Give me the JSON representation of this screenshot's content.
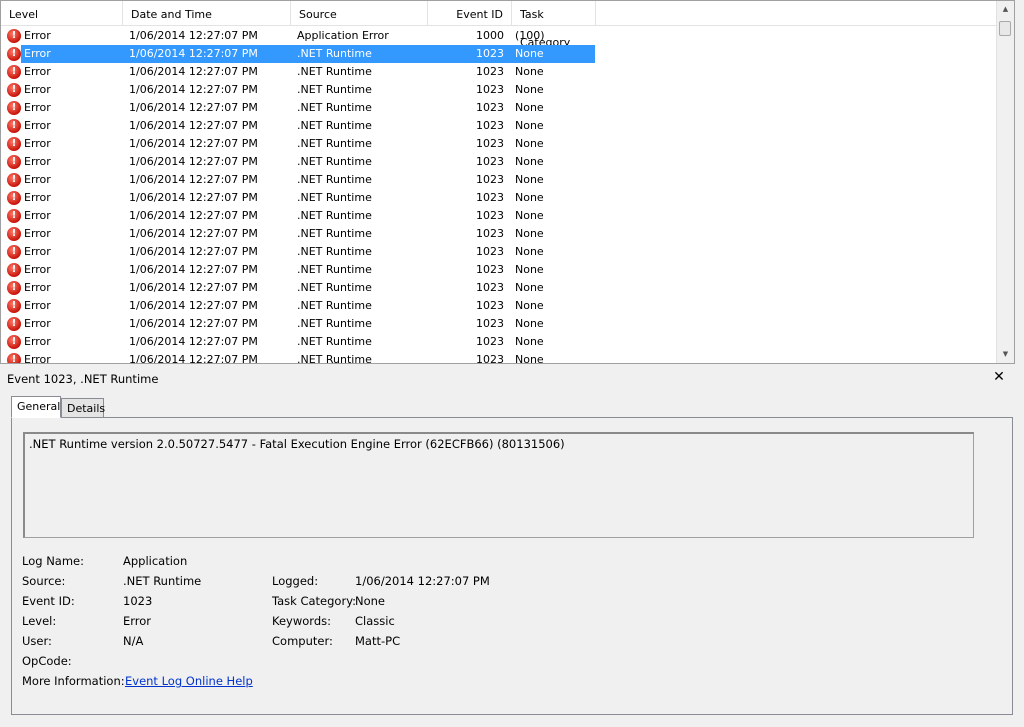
{
  "columns": {
    "level": "Level",
    "date_time": "Date and Time",
    "source": "Source",
    "event_id": "Event ID",
    "task_category": "Task Category"
  },
  "icons": {
    "error": "error-icon",
    "close": "close-icon"
  },
  "colors": {
    "selection": "#3399ff",
    "error_red": "#c8140a",
    "link": "#0033cc"
  },
  "events": [
    {
      "level": "Error",
      "date": "1/06/2014 12:27:07 PM",
      "source": "Application Error",
      "id": "1000",
      "category": "(100)",
      "selected": false
    },
    {
      "level": "Error",
      "date": "1/06/2014 12:27:07 PM",
      "source": ".NET Runtime",
      "id": "1023",
      "category": "None",
      "selected": true
    },
    {
      "level": "Error",
      "date": "1/06/2014 12:27:07 PM",
      "source": ".NET Runtime",
      "id": "1023",
      "category": "None",
      "selected": false
    },
    {
      "level": "Error",
      "date": "1/06/2014 12:27:07 PM",
      "source": ".NET Runtime",
      "id": "1023",
      "category": "None",
      "selected": false
    },
    {
      "level": "Error",
      "date": "1/06/2014 12:27:07 PM",
      "source": ".NET Runtime",
      "id": "1023",
      "category": "None",
      "selected": false
    },
    {
      "level": "Error",
      "date": "1/06/2014 12:27:07 PM",
      "source": ".NET Runtime",
      "id": "1023",
      "category": "None",
      "selected": false
    },
    {
      "level": "Error",
      "date": "1/06/2014 12:27:07 PM",
      "source": ".NET Runtime",
      "id": "1023",
      "category": "None",
      "selected": false
    },
    {
      "level": "Error",
      "date": "1/06/2014 12:27:07 PM",
      "source": ".NET Runtime",
      "id": "1023",
      "category": "None",
      "selected": false
    },
    {
      "level": "Error",
      "date": "1/06/2014 12:27:07 PM",
      "source": ".NET Runtime",
      "id": "1023",
      "category": "None",
      "selected": false
    },
    {
      "level": "Error",
      "date": "1/06/2014 12:27:07 PM",
      "source": ".NET Runtime",
      "id": "1023",
      "category": "None",
      "selected": false
    },
    {
      "level": "Error",
      "date": "1/06/2014 12:27:07 PM",
      "source": ".NET Runtime",
      "id": "1023",
      "category": "None",
      "selected": false
    },
    {
      "level": "Error",
      "date": "1/06/2014 12:27:07 PM",
      "source": ".NET Runtime",
      "id": "1023",
      "category": "None",
      "selected": false
    },
    {
      "level": "Error",
      "date": "1/06/2014 12:27:07 PM",
      "source": ".NET Runtime",
      "id": "1023",
      "category": "None",
      "selected": false
    },
    {
      "level": "Error",
      "date": "1/06/2014 12:27:07 PM",
      "source": ".NET Runtime",
      "id": "1023",
      "category": "None",
      "selected": false
    },
    {
      "level": "Error",
      "date": "1/06/2014 12:27:07 PM",
      "source": ".NET Runtime",
      "id": "1023",
      "category": "None",
      "selected": false
    },
    {
      "level": "Error",
      "date": "1/06/2014 12:27:07 PM",
      "source": ".NET Runtime",
      "id": "1023",
      "category": "None",
      "selected": false
    },
    {
      "level": "Error",
      "date": "1/06/2014 12:27:07 PM",
      "source": ".NET Runtime",
      "id": "1023",
      "category": "None",
      "selected": false
    },
    {
      "level": "Error",
      "date": "1/06/2014 12:27:07 PM",
      "source": ".NET Runtime",
      "id": "1023",
      "category": "None",
      "selected": false
    },
    {
      "level": "Error",
      "date": "1/06/2014 12:27:07 PM",
      "source": ".NET Runtime",
      "id": "1023",
      "category": "None",
      "selected": false
    }
  ],
  "details": {
    "title": "Event 1023, .NET Runtime",
    "tabs": {
      "general": "General",
      "details": "Details"
    },
    "message": ".NET Runtime version 2.0.50727.5477 - Fatal Execution Engine Error (62ECFB66) (80131506)",
    "labels": {
      "log_name": "Log Name:",
      "source": "Source:",
      "event_id": "Event ID:",
      "level": "Level:",
      "user": "User:",
      "opcode": "OpCode:",
      "more_info": "More Information:",
      "logged": "Logged:",
      "task_category": "Task Category:",
      "keywords": "Keywords:",
      "computer": "Computer:"
    },
    "values": {
      "log_name": "Application",
      "source": ".NET Runtime",
      "event_id": "1023",
      "level": "Error",
      "user": "N/A",
      "opcode": "",
      "more_info_link": "Event Log Online Help",
      "logged": "1/06/2014 12:27:07 PM",
      "task_category": "None",
      "keywords": "Classic",
      "computer": "Matt-PC"
    }
  }
}
